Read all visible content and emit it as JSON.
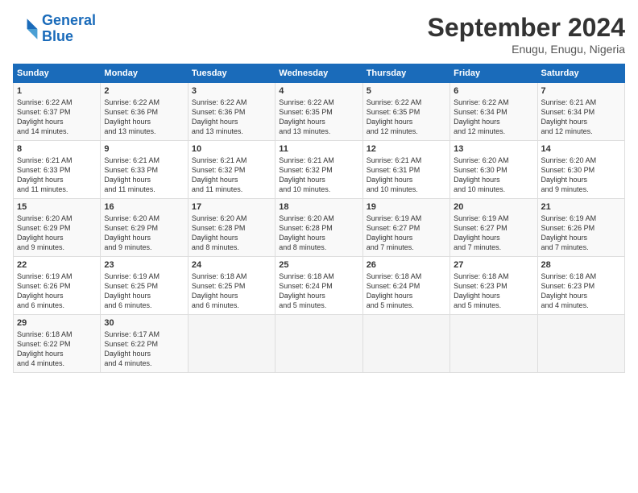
{
  "header": {
    "logo_line1": "General",
    "logo_line2": "Blue",
    "month": "September 2024",
    "location": "Enugu, Enugu, Nigeria"
  },
  "days_of_week": [
    "Sunday",
    "Monday",
    "Tuesday",
    "Wednesday",
    "Thursday",
    "Friday",
    "Saturday"
  ],
  "weeks": [
    [
      {
        "day": "1",
        "sunrise": "6:22 AM",
        "sunset": "6:37 PM",
        "daylight": "12 hours and 14 minutes."
      },
      {
        "day": "2",
        "sunrise": "6:22 AM",
        "sunset": "6:36 PM",
        "daylight": "12 hours and 13 minutes."
      },
      {
        "day": "3",
        "sunrise": "6:22 AM",
        "sunset": "6:36 PM",
        "daylight": "12 hours and 13 minutes."
      },
      {
        "day": "4",
        "sunrise": "6:22 AM",
        "sunset": "6:35 PM",
        "daylight": "12 hours and 13 minutes."
      },
      {
        "day": "5",
        "sunrise": "6:22 AM",
        "sunset": "6:35 PM",
        "daylight": "12 hours and 12 minutes."
      },
      {
        "day": "6",
        "sunrise": "6:22 AM",
        "sunset": "6:34 PM",
        "daylight": "12 hours and 12 minutes."
      },
      {
        "day": "7",
        "sunrise": "6:21 AM",
        "sunset": "6:34 PM",
        "daylight": "12 hours and 12 minutes."
      }
    ],
    [
      {
        "day": "8",
        "sunrise": "6:21 AM",
        "sunset": "6:33 PM",
        "daylight": "12 hours and 11 minutes."
      },
      {
        "day": "9",
        "sunrise": "6:21 AM",
        "sunset": "6:33 PM",
        "daylight": "12 hours and 11 minutes."
      },
      {
        "day": "10",
        "sunrise": "6:21 AM",
        "sunset": "6:32 PM",
        "daylight": "12 hours and 11 minutes."
      },
      {
        "day": "11",
        "sunrise": "6:21 AM",
        "sunset": "6:32 PM",
        "daylight": "12 hours and 10 minutes."
      },
      {
        "day": "12",
        "sunrise": "6:21 AM",
        "sunset": "6:31 PM",
        "daylight": "12 hours and 10 minutes."
      },
      {
        "day": "13",
        "sunrise": "6:20 AM",
        "sunset": "6:30 PM",
        "daylight": "12 hours and 10 minutes."
      },
      {
        "day": "14",
        "sunrise": "6:20 AM",
        "sunset": "6:30 PM",
        "daylight": "12 hours and 9 minutes."
      }
    ],
    [
      {
        "day": "15",
        "sunrise": "6:20 AM",
        "sunset": "6:29 PM",
        "daylight": "12 hours and 9 minutes."
      },
      {
        "day": "16",
        "sunrise": "6:20 AM",
        "sunset": "6:29 PM",
        "daylight": "12 hours and 9 minutes."
      },
      {
        "day": "17",
        "sunrise": "6:20 AM",
        "sunset": "6:28 PM",
        "daylight": "12 hours and 8 minutes."
      },
      {
        "day": "18",
        "sunrise": "6:20 AM",
        "sunset": "6:28 PM",
        "daylight": "12 hours and 8 minutes."
      },
      {
        "day": "19",
        "sunrise": "6:19 AM",
        "sunset": "6:27 PM",
        "daylight": "12 hours and 7 minutes."
      },
      {
        "day": "20",
        "sunrise": "6:19 AM",
        "sunset": "6:27 PM",
        "daylight": "12 hours and 7 minutes."
      },
      {
        "day": "21",
        "sunrise": "6:19 AM",
        "sunset": "6:26 PM",
        "daylight": "12 hours and 7 minutes."
      }
    ],
    [
      {
        "day": "22",
        "sunrise": "6:19 AM",
        "sunset": "6:26 PM",
        "daylight": "12 hours and 6 minutes."
      },
      {
        "day": "23",
        "sunrise": "6:19 AM",
        "sunset": "6:25 PM",
        "daylight": "12 hours and 6 minutes."
      },
      {
        "day": "24",
        "sunrise": "6:18 AM",
        "sunset": "6:25 PM",
        "daylight": "12 hours and 6 minutes."
      },
      {
        "day": "25",
        "sunrise": "6:18 AM",
        "sunset": "6:24 PM",
        "daylight": "12 hours and 5 minutes."
      },
      {
        "day": "26",
        "sunrise": "6:18 AM",
        "sunset": "6:24 PM",
        "daylight": "12 hours and 5 minutes."
      },
      {
        "day": "27",
        "sunrise": "6:18 AM",
        "sunset": "6:23 PM",
        "daylight": "12 hours and 5 minutes."
      },
      {
        "day": "28",
        "sunrise": "6:18 AM",
        "sunset": "6:23 PM",
        "daylight": "12 hours and 4 minutes."
      }
    ],
    [
      {
        "day": "29",
        "sunrise": "6:18 AM",
        "sunset": "6:22 PM",
        "daylight": "12 hours and 4 minutes."
      },
      {
        "day": "30",
        "sunrise": "6:17 AM",
        "sunset": "6:22 PM",
        "daylight": "12 hours and 4 minutes."
      },
      {
        "day": "",
        "sunrise": "",
        "sunset": "",
        "daylight": ""
      },
      {
        "day": "",
        "sunrise": "",
        "sunset": "",
        "daylight": ""
      },
      {
        "day": "",
        "sunrise": "",
        "sunset": "",
        "daylight": ""
      },
      {
        "day": "",
        "sunrise": "",
        "sunset": "",
        "daylight": ""
      },
      {
        "day": "",
        "sunrise": "",
        "sunset": "",
        "daylight": ""
      }
    ]
  ]
}
